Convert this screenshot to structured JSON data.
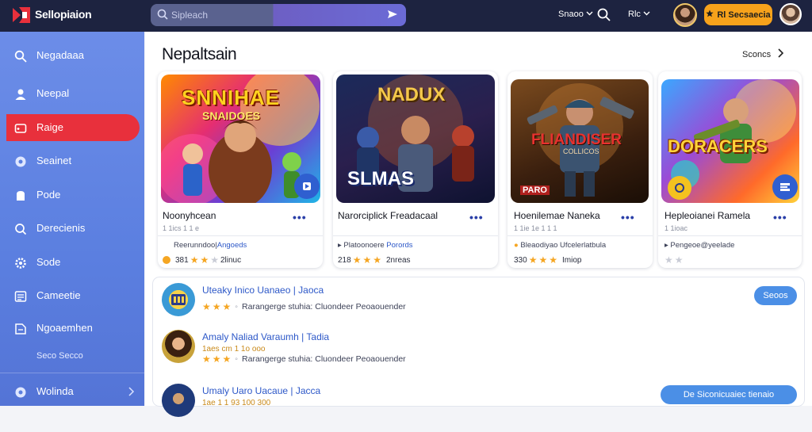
{
  "app": {
    "name": "Sellopiaion"
  },
  "search": {
    "placeholder": "Sipleach"
  },
  "topbar": {
    "sort_label": "Snaoo",
    "filter_label": "Rlc",
    "cta_label": "Rl Secsaecia"
  },
  "sidebar": {
    "items": [
      {
        "label": "Negadaaa",
        "icon": "search-icon"
      },
      {
        "label": "Neepal",
        "icon": "user-icon"
      },
      {
        "label": "Raige",
        "icon": "gamepad-icon",
        "active": true
      },
      {
        "label": "Seainet",
        "icon": "globe-icon"
      },
      {
        "label": "Pode",
        "icon": "bag-icon"
      },
      {
        "label": "Derecienis",
        "icon": "refresh-icon"
      },
      {
        "label": "Sode",
        "icon": "gear-icon"
      },
      {
        "label": "Cameetie",
        "icon": "list-icon"
      },
      {
        "label": "Ngoaemhen",
        "icon": "doc-icon"
      }
    ],
    "sub_label": "Seco Secco",
    "footer_label": "Wolinda"
  },
  "section": {
    "title": "Nepaltsain",
    "see_all": "Sconcs"
  },
  "cards": [
    {
      "art_title": "SNNIHAE",
      "art_subtitle": "SNAIDOES",
      "title": "Noonyhcean",
      "sub": "1 1ics 1 1 e",
      "developer": "Reerunndoo|",
      "developer_link": "Angoeds",
      "rating_value": "381",
      "rating_stars": 3,
      "rating_text": "2linuc",
      "accent": "#2f5fd0"
    },
    {
      "art_title": "NADUX",
      "art_subtitle": "SLMAS",
      "title": "Narorciplick Freadacaal",
      "sub": "",
      "developer": "Platoonoere",
      "developer_link": "Porords",
      "rating_value": "218",
      "rating_stars": 3,
      "rating_text": "2nreas",
      "accent": "#2f5fd0"
    },
    {
      "art_title": "FLIANDISER",
      "art_subtitle": "COLLICOS",
      "badge": "PARO",
      "title": "Hoenilemae Naneka",
      "sub": "1 1ie 1e 1 1 1",
      "developer": "Bleaodiyao Ufcelerlatbula",
      "developer_link": "",
      "rating_value": "330",
      "rating_stars": 3,
      "rating_text": "Imiop",
      "accent": "#2f5fd0"
    },
    {
      "art_title": "DORACERS",
      "art_subtitle": "",
      "title": "Hepleoianei Ramela",
      "sub": "1 1ioac",
      "developer": "Pengeoe@yeelade",
      "developer_link": "",
      "rating_value": "",
      "rating_stars": 0,
      "rating_text": "",
      "accent": "#2f5fd0"
    }
  ],
  "list": [
    {
      "title": "Uteaky Inico Uanaeo | Jaoca",
      "sub": "",
      "meta": "Rarangerge stuhia: Cluondeer   Peoaouender",
      "rating_stars": 3,
      "button": "Seoos"
    },
    {
      "title": "Amaly Naliad Varaumh | Tadia",
      "sub": "1aes cm 1 1o ooo",
      "meta": "Rarangerge stuhia: Cluondeer   Peoaouender",
      "rating_stars": 3,
      "button": ""
    },
    {
      "title": "Umaly Uaro Uacaue | Jacca",
      "sub": "1ae 1 1 93 100 300",
      "meta": "",
      "rating_stars": 0,
      "button": "De Siconicuaiec tienaio"
    }
  ]
}
